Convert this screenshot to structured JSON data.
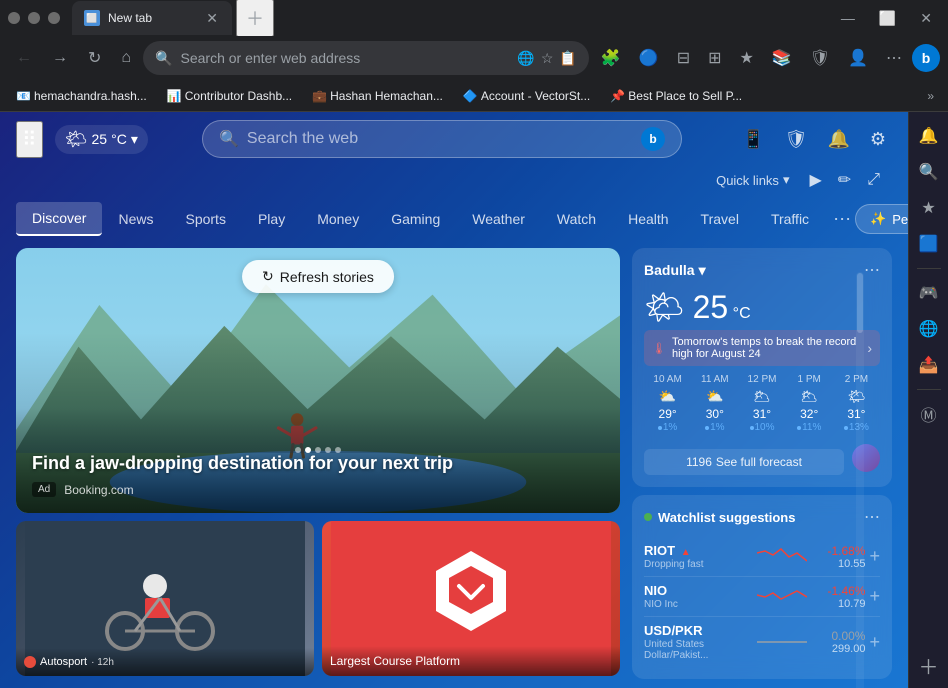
{
  "browser": {
    "tab": {
      "label": "New tab",
      "favicon": "⬜"
    },
    "address_bar": {
      "placeholder": "Search or enter web address"
    },
    "bookmarks": [
      {
        "favicon": "📧",
        "label": "hemachandra.hash..."
      },
      {
        "favicon": "📊",
        "label": "Contributor Dashb..."
      },
      {
        "favicon": "💼",
        "label": "Hashan Hemachan..."
      },
      {
        "favicon": "🔷",
        "label": "Account - VectorSt..."
      },
      {
        "favicon": "📌",
        "label": "Best Place to Sell P..."
      }
    ]
  },
  "newtab": {
    "weather_topbar": {
      "icon": "🌤",
      "temp": "25",
      "unit": "°C",
      "chevron": "▾"
    },
    "search": {
      "placeholder": "Search the web"
    },
    "quicklinks": {
      "label": "Quick links",
      "chevron": "▾"
    },
    "nav": {
      "items": [
        {
          "id": "discover",
          "label": "Discover",
          "active": true
        },
        {
          "id": "news",
          "label": "News"
        },
        {
          "id": "sports",
          "label": "Sports"
        },
        {
          "id": "play",
          "label": "Play"
        },
        {
          "id": "money",
          "label": "Money"
        },
        {
          "id": "gaming",
          "label": "Gaming"
        },
        {
          "id": "weather",
          "label": "Weather"
        },
        {
          "id": "watch",
          "label": "Watch"
        },
        {
          "id": "health",
          "label": "Health"
        },
        {
          "id": "travel",
          "label": "Travel"
        },
        {
          "id": "traffic",
          "label": "Traffic"
        }
      ],
      "personalize_label": "Personalize"
    },
    "feed": {
      "hero": {
        "title": "Find a jaw-dropping destination for your next trip",
        "ad_label": "Ad",
        "source": "Booking.com",
        "refresh_label": "Refresh stories"
      },
      "cards": [
        {
          "type": "moto",
          "source_icon": "🏍",
          "source": "Autosport",
          "time": "12h",
          "title": ""
        },
        {
          "type": "logo",
          "title": "Largest Course Platform",
          "source": "",
          "time": ""
        }
      ]
    },
    "weather_widget": {
      "location": "Badulla",
      "temp": "25",
      "unit": "°C",
      "icon": "🌤",
      "alert_text": "Tomorrow's temps to break the record high for August 24",
      "hourly": [
        {
          "time": "10 AM",
          "icon": "⛅",
          "temp": "29°",
          "precip": "1%"
        },
        {
          "time": "11 AM",
          "icon": "⛅",
          "temp": "30°",
          "precip": "1%"
        },
        {
          "time": "12 PM",
          "icon": "🌥",
          "temp": "31°",
          "precip": "10%"
        },
        {
          "time": "1 PM",
          "icon": "🌥",
          "temp": "32°",
          "precip": "11%"
        },
        {
          "time": "2 PM",
          "icon": "🌤",
          "temp": "31°",
          "precip": "13%"
        }
      ],
      "forecast_label": "See full forecast",
      "forecast_number": "1196"
    },
    "watchlist": {
      "title": "Watchlist suggestions",
      "stocks": [
        {
          "symbol": "RIOT",
          "trend": "down",
          "trend_label": "Dropping fast",
          "name": "",
          "change": "-1.68%",
          "price": "10.55"
        },
        {
          "symbol": "NIO",
          "trend": "down",
          "trend_label": "",
          "name": "NIO Inc",
          "change": "-1.46%",
          "price": "10.79"
        },
        {
          "symbol": "USD/PKR",
          "trend": "flat",
          "trend_label": "",
          "name": "United States Dollar/Pakist...",
          "change": "0.00%",
          "price": "299.00"
        }
      ]
    }
  },
  "sidebar": {
    "icons": [
      {
        "name": "notification-bell-icon",
        "glyph": "🔔",
        "active": true
      },
      {
        "name": "search-icon",
        "glyph": "🔍"
      },
      {
        "name": "favorites-icon",
        "glyph": "⭐"
      },
      {
        "name": "settings-icon",
        "glyph": "⚙"
      },
      {
        "name": "microsoft-icon",
        "glyph": "🟦"
      },
      {
        "name": "translate-icon",
        "glyph": "🌐"
      },
      {
        "name": "share-icon",
        "glyph": "📤"
      }
    ]
  },
  "colors": {
    "accent_blue": "#0078d4",
    "bg_dark": "#202124",
    "tab_bg": "#35363a",
    "positive": "#4caf50",
    "negative": "#f44336"
  }
}
